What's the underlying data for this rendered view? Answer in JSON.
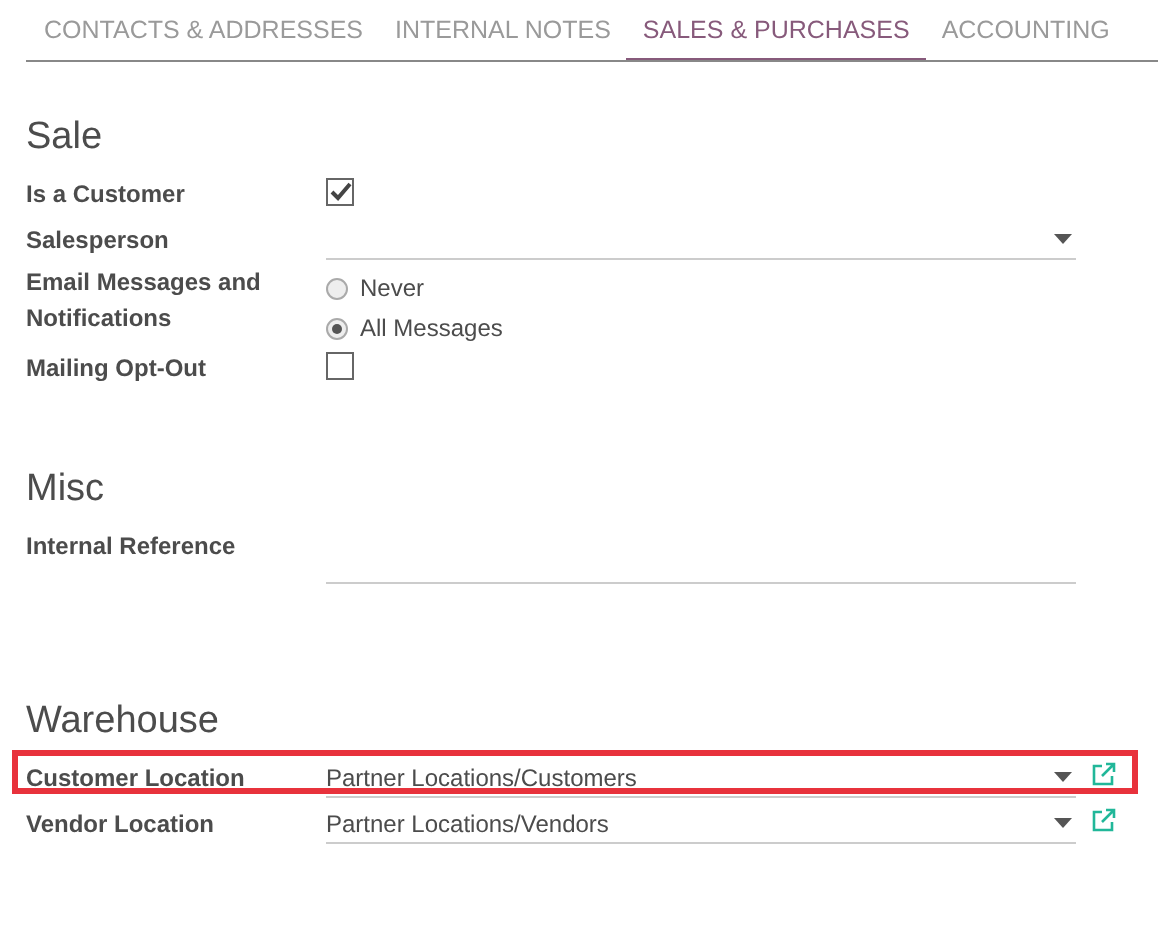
{
  "tabs": [
    {
      "label": "CONTACTS & ADDRESSES",
      "selected": false
    },
    {
      "label": "INTERNAL NOTES",
      "selected": false
    },
    {
      "label": "SALES & PURCHASES",
      "selected": true
    },
    {
      "label": "ACCOUNTING",
      "selected": false
    }
  ],
  "sections": [
    {
      "title": "Sale",
      "fields": [
        {
          "kind": "checkbox",
          "label": "Is a Customer",
          "checked": true
        },
        {
          "kind": "select",
          "label": "Salesperson"
        },
        {
          "kind": "radio",
          "label": "Email Messages and Notifications",
          "options": [
            {
              "label": "Never",
              "selected": false
            },
            {
              "label": "All Messages",
              "selected": true
            }
          ]
        },
        {
          "kind": "checkbox",
          "label": "Mailing Opt-Out",
          "checked": false
        }
      ]
    },
    {
      "title": "Misc",
      "fields": [
        {
          "kind": "text",
          "label": "Internal Reference"
        }
      ]
    },
    {
      "title": "Warehouse",
      "fields": [
        {
          "kind": "select",
          "label": "Customer Location",
          "value": "Partner Locations/Customers",
          "external_link": true,
          "highlighted": true
        },
        {
          "kind": "select",
          "label": "Vendor Location",
          "value": "Partner Locations/Vendors",
          "external_link": true,
          "highlighted": false
        }
      ]
    }
  ]
}
